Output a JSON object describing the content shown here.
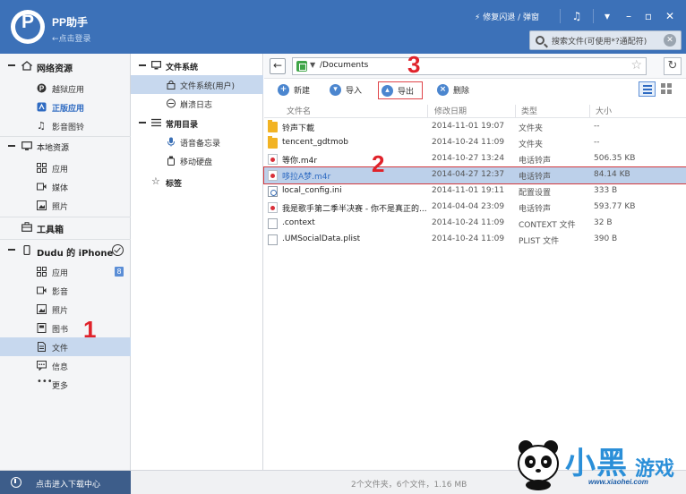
{
  "titlebar": {
    "app_name": "PP助手",
    "login_hint": "←点击登录",
    "fix_crash_link": "修复闪退 / 弹窗",
    "search_placeholder": "搜索文件(可使用*?通配符)"
  },
  "sidebar": {
    "network_group": "网络资源",
    "network_items": [
      "越狱应用",
      "正版应用",
      "影音图铃"
    ],
    "local_group": "本地资源",
    "local_items": [
      "应用",
      "媒体",
      "照片"
    ],
    "toolbox_group": "工具箱",
    "device_group": "Dudu 的 iPhone",
    "device_items": [
      "应用",
      "影音",
      "照片",
      "图书",
      "文件",
      "信息",
      "更多"
    ],
    "apps_badge": "8",
    "download_center": "点击进入下载中心"
  },
  "tree": {
    "filesystem_group": "文件系统",
    "filesystem_items": [
      "文件系统(用户)",
      "崩溃日志"
    ],
    "common_group": "常用目录",
    "common_items": [
      "语音备忘录",
      "移动硬盘"
    ],
    "tags_group": "标签"
  },
  "main": {
    "path": "/Documents",
    "tools": {
      "new": "新建",
      "import": "导入",
      "export": "导出",
      "delete": "删除"
    },
    "columns": [
      "文件名",
      "修改日期",
      "类型",
      "大小"
    ],
    "files": [
      {
        "name": "铃声下載",
        "date": "2014-11-01 19:07",
        "type": "文件夹",
        "size": "--",
        "icon": "folder-icon"
      },
      {
        "name": "tencent_gdtmob",
        "date": "2014-10-24 11:09",
        "type": "文件夹",
        "size": "--",
        "icon": "folder-icon"
      },
      {
        "name": "等你.m4r",
        "date": "2014-10-27 13:24",
        "type": "电话铃声",
        "size": "506.35 KB",
        "icon": "ringtone-file-icon"
      },
      {
        "name": "哆拉A梦.m4r",
        "date": "2014-04-27 12:37",
        "type": "电话铃声",
        "size": "84.14 KB",
        "icon": "ringtone-file-icon"
      },
      {
        "name": "local_config.ini",
        "date": "2014-11-01 19:11",
        "type": "配置设置",
        "size": "333 B",
        "icon": "config-file-icon"
      },
      {
        "name": "我是歌手第二季半决赛 - 你不是真正的...",
        "date": "2014-04-04 23:09",
        "type": "电话铃声",
        "size": "593.77 KB",
        "icon": "ringtone-file-icon"
      },
      {
        "name": ".context",
        "date": "2014-10-24 11:09",
        "type": "CONTEXT 文件",
        "size": "32 B",
        "icon": "file-icon"
      },
      {
        "name": ".UMSocialData.plist",
        "date": "2014-10-24 11:09",
        "type": "PLIST 文件",
        "size": "390 B",
        "icon": "file-icon"
      }
    ],
    "status": "2个文件夹，6个文件，1.16 MB"
  },
  "annotations": [
    "1",
    "2",
    "3"
  ],
  "watermark": {
    "brand": "小黑",
    "brand2": "游戏",
    "url": "www.xiaohei.com"
  },
  "colors": {
    "titlebar": "#3c71b8",
    "selection": "#c7d8ee",
    "annotation_red": "#e0222a",
    "accent_blue": "#2f6bc2"
  }
}
